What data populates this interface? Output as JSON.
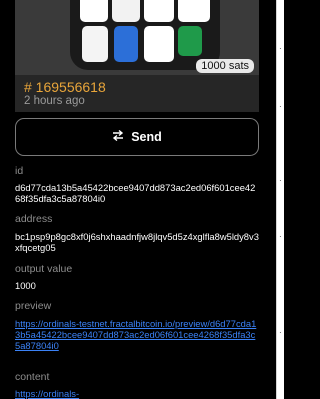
{
  "inscription": {
    "badge": "1000 sats",
    "number": "# 169556618",
    "time": "2 hours ago",
    "colors": {
      "accent": "#e8a53a",
      "link": "#3b82f6"
    }
  },
  "actions": {
    "send_label": "Send",
    "send_icon": "swap-arrows-icon"
  },
  "fields": {
    "id_label": "id",
    "id_value": "d6d77cda13b5a45422bcee9407dd873ac2ed06f601cee4268f35dfa3c5a87804i0",
    "address_label": "address",
    "address_value": "bc1psp9p8gc8xf0j6shxhaadnfjw8jlqv5d5z4xglfla8w5ldy8v3xfqcetg05",
    "output_label": "output value",
    "output_value": "1000",
    "preview_label": "preview",
    "preview_url": "https://ordinals-testnet.fractalbitcoin.io/preview/d6d77cda13b5a45422bcee9407dd873ac2ed06f601cee4268f35dfa3c5a87804i0",
    "content_label": "content",
    "content_url": "https://ordinals-"
  }
}
